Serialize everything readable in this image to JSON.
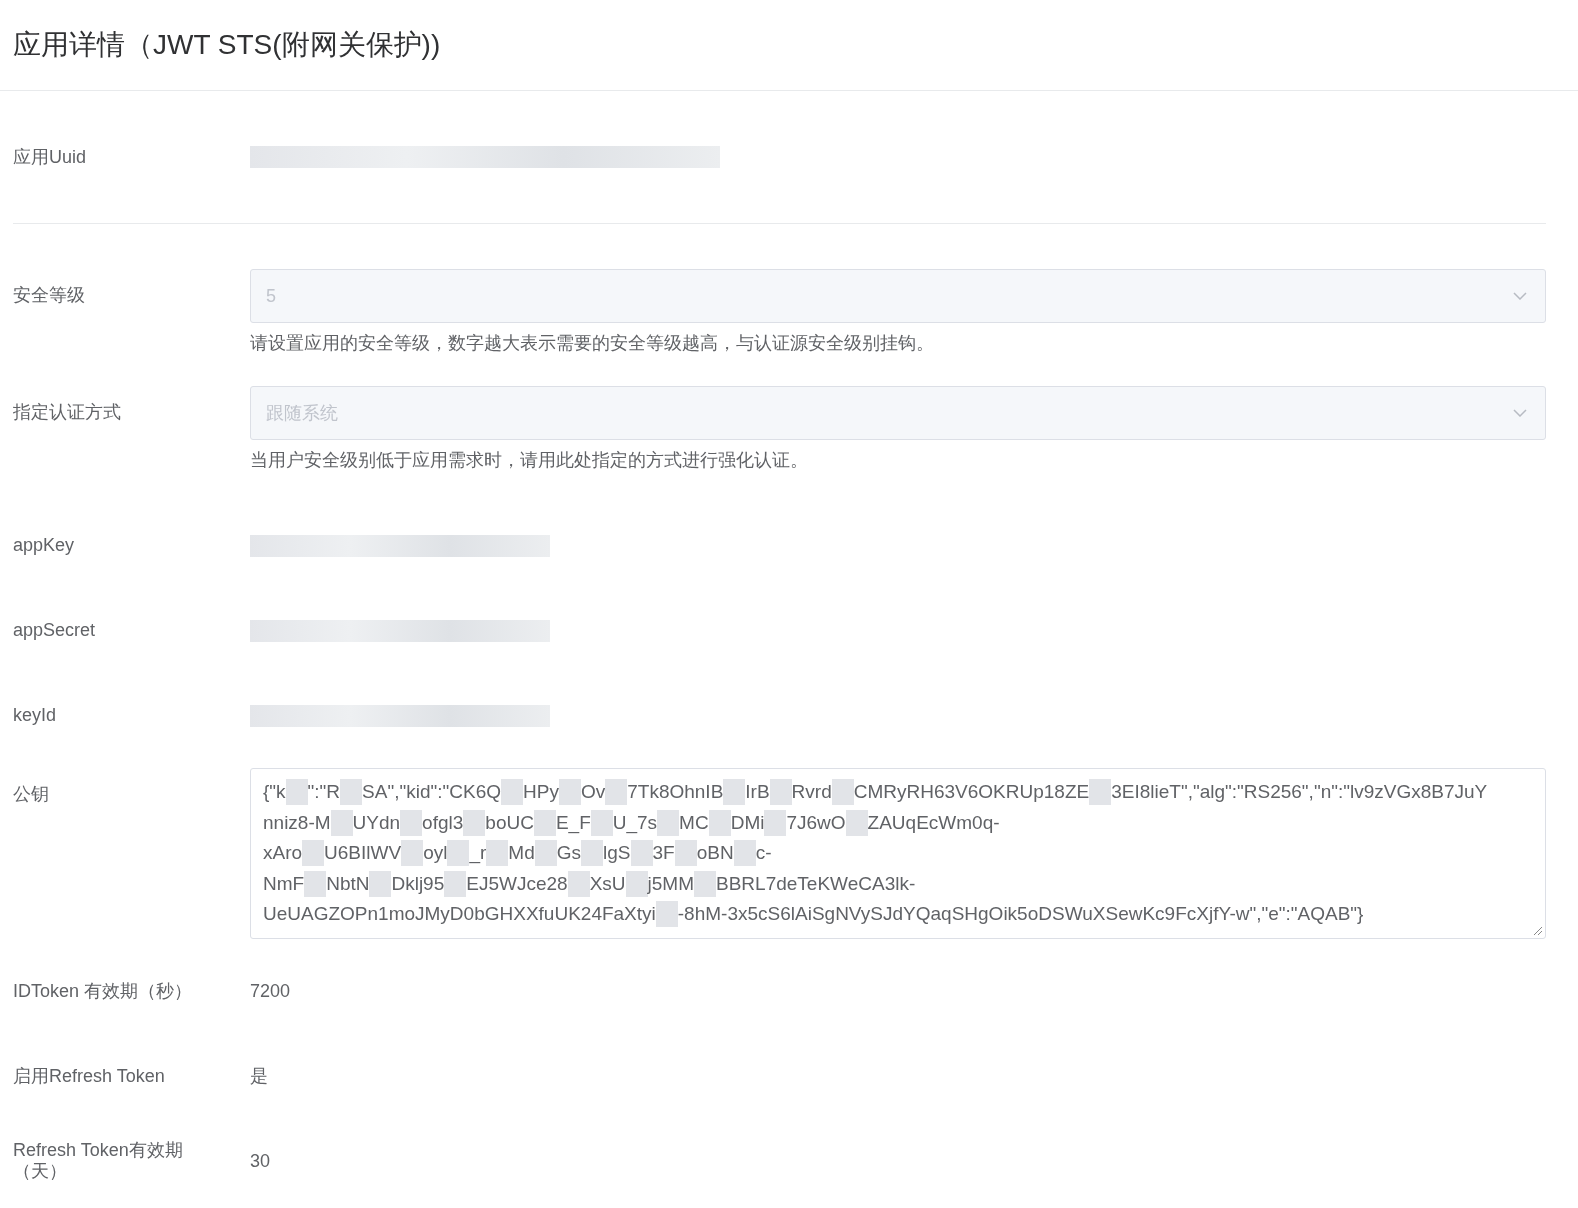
{
  "page_title": "应用详情（JWT STS(附网关保护))",
  "header_row": {
    "label": "应用Uuid",
    "kind": "redacted"
  },
  "rows": [
    {
      "label": "安全等级",
      "kind": "select",
      "value": "5",
      "disabled": true,
      "help": "请设置应用的安全等级，数字越大表示需要的安全等级越高，与认证源安全级别挂钩。"
    },
    {
      "label": "指定认证方式",
      "kind": "select",
      "value": "跟随系统",
      "disabled": true,
      "help": "当用户安全级别低于应用需求时，请用此处指定的方式进行强化认证。"
    },
    {
      "label": "appKey",
      "kind": "redacted"
    },
    {
      "label": "appSecret",
      "kind": "redacted"
    },
    {
      "label": "keyId",
      "kind": "redacted"
    },
    {
      "label": "公钥",
      "kind": "key",
      "lines": [
        [
          {
            "kind": "text",
            "text": "{\"k"
          },
          {
            "kind": "redacted"
          },
          {
            "kind": "text",
            "text": "\":\"R"
          },
          {
            "kind": "redacted"
          },
          {
            "kind": "text",
            "text": "SA\",\"kid\":\"CK6Q"
          },
          {
            "kind": "redacted"
          },
          {
            "kind": "text",
            "text": "HPy"
          },
          {
            "kind": "redacted"
          },
          {
            "kind": "text",
            "text": "Ov"
          },
          {
            "kind": "redacted"
          },
          {
            "kind": "text",
            "text": "7Tk8OhnIB"
          },
          {
            "kind": "redacted"
          },
          {
            "kind": "text",
            "text": "IrB"
          },
          {
            "kind": "redacted"
          },
          {
            "kind": "text",
            "text": "Rvrd"
          },
          {
            "kind": "redacted"
          },
          {
            "kind": "text",
            "text": "CMRyRH63V6OKRUp18ZE"
          },
          {
            "kind": "redacted"
          },
          {
            "kind": "text",
            "text": "3EI8lieT\",\"alg\":\"RS256\",\"n\":\"lv9zVGx8B7JuY"
          }
        ],
        [
          {
            "kind": "text",
            "text": "nniz8-M"
          },
          {
            "kind": "redacted"
          },
          {
            "kind": "text",
            "text": "UYdn"
          },
          {
            "kind": "redacted"
          },
          {
            "kind": "text",
            "text": "ofgl3"
          },
          {
            "kind": "redacted"
          },
          {
            "kind": "text",
            "text": "boUC"
          },
          {
            "kind": "redacted"
          },
          {
            "kind": "text",
            "text": "E_F"
          },
          {
            "kind": "redacted"
          },
          {
            "kind": "text",
            "text": "U_7s"
          },
          {
            "kind": "redacted"
          },
          {
            "kind": "text",
            "text": "MC"
          },
          {
            "kind": "redacted"
          },
          {
            "kind": "text",
            "text": "DMi"
          },
          {
            "kind": "redacted"
          },
          {
            "kind": "text",
            "text": "7J6wO"
          },
          {
            "kind": "redacted"
          },
          {
            "kind": "text",
            "text": "ZAUqEcWm0q-"
          }
        ],
        [
          {
            "kind": "text",
            "text": "xAro"
          },
          {
            "kind": "redacted"
          },
          {
            "kind": "text",
            "text": "U6BIlWV"
          },
          {
            "kind": "redacted"
          },
          {
            "kind": "text",
            "text": "oyl"
          },
          {
            "kind": "redacted"
          },
          {
            "kind": "text",
            "text": "_r"
          },
          {
            "kind": "redacted"
          },
          {
            "kind": "text",
            "text": "Md"
          },
          {
            "kind": "redacted"
          },
          {
            "kind": "text",
            "text": "Gs"
          },
          {
            "kind": "redacted"
          },
          {
            "kind": "text",
            "text": "lgS"
          },
          {
            "kind": "redacted"
          },
          {
            "kind": "text",
            "text": "3F"
          },
          {
            "kind": "redacted"
          },
          {
            "kind": "text",
            "text": "oBN"
          },
          {
            "kind": "redacted"
          },
          {
            "kind": "text",
            "text": "c-"
          }
        ],
        [
          {
            "kind": "text",
            "text": "NmF"
          },
          {
            "kind": "redacted"
          },
          {
            "kind": "text",
            "text": "NbtN"
          },
          {
            "kind": "redacted"
          },
          {
            "kind": "text",
            "text": "Dklj95"
          },
          {
            "kind": "redacted"
          },
          {
            "kind": "text",
            "text": "EJ5WJce28"
          },
          {
            "kind": "redacted"
          },
          {
            "kind": "text",
            "text": "XsU"
          },
          {
            "kind": "redacted"
          },
          {
            "kind": "text",
            "text": "j5MM"
          },
          {
            "kind": "redacted"
          },
          {
            "kind": "text",
            "text": "BBRL7deTeKWeCA3lk-"
          }
        ],
        [
          {
            "kind": "text",
            "text": "UeUAGZOPn1moJMyD0bGHXXfuUK24FaXtyi"
          },
          {
            "kind": "redacted"
          },
          {
            "kind": "text",
            "text": "-8hM-3x5cS6lAiSgNVySJdYQaqSHgOik5oDSWuXSewKc9FcXjfY-w\",\"e\":\"AQAB\"}"
          }
        ]
      ]
    },
    {
      "label": "IDToken 有效期（秒）",
      "kind": "text",
      "value": "7200"
    },
    {
      "label": "启用Refresh Token",
      "kind": "text",
      "value": "是"
    },
    {
      "label": "Refresh Token有效期（天）",
      "kind": "text",
      "value": "30"
    }
  ]
}
